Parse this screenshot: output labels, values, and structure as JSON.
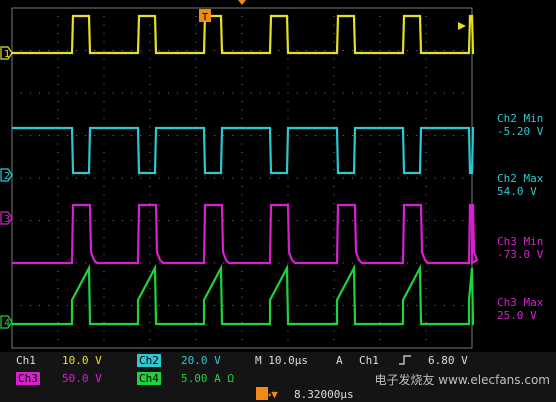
{
  "colors": {
    "ch1": "#e6e020",
    "ch2": "#2fc8d2",
    "ch3": "#d820d0",
    "ch4": "#1fd43a",
    "grid": "#7a7a7a",
    "trigger": "#f08a10",
    "bar_bg": "#141414"
  },
  "markers": {
    "ch1": "1",
    "ch2": "2",
    "ch3": "3",
    "ch4": "4",
    "trigger_pos": "T"
  },
  "measurements": [
    {
      "title": "Ch2 Min",
      "value": "-5.20 V",
      "color_key": "ch2"
    },
    {
      "title": "Ch2 Max",
      "value": "54.0 V",
      "color_key": "ch2"
    },
    {
      "title": "Ch3 Min",
      "value": "-73.0 V",
      "color_key": "ch3"
    },
    {
      "title": "Ch3 Max",
      "value": "25.0 V",
      "color_key": "ch3"
    }
  ],
  "status_bar": {
    "ch1_label": "Ch1",
    "ch1_scale": "10.0 V",
    "ch2_label": "Ch2",
    "ch2_scale": "20.0 V",
    "ch3_label": "Ch3",
    "ch3_scale": "50.0 V",
    "ch4_label": "Ch4",
    "ch4_scale": "5.00 A Ω",
    "timebase": "M 10.0µs",
    "trigger_mode": "A",
    "trigger_source": "Ch1",
    "trigger_level_partial": "6.80 V",
    "position_prefix": "T→▼",
    "position_value": "8.32000µs"
  },
  "watermark": "电子发烧友 www.elecfans.com"
}
